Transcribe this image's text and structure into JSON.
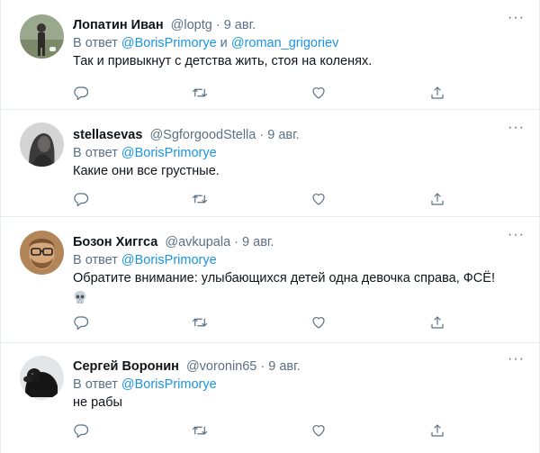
{
  "tweets": [
    {
      "name": "Лопатин Иван",
      "handle": "@loptg",
      "sep": " · ",
      "date": "9 авг.",
      "reply_prefix": "В ответ ",
      "reply_to": "@BorisPrimorye",
      "reply_and": " и ",
      "reply_to2": "@roman_grigoriev",
      "text": "Так и привыкнут с детства жить, стоя на коленях.",
      "avatar": "avatar-person-photo"
    },
    {
      "name": "stellasevas",
      "handle": "@SgforgoodStella",
      "sep": " · ",
      "date": "9 авг.",
      "reply_prefix": "В ответ ",
      "reply_to": "@BorisPrimorye",
      "text": "Какие они все грустные.",
      "avatar": "avatar-dark-portrait"
    },
    {
      "name": "Бозон Хиггса",
      "handle": "@avkupala",
      "sep": " · ",
      "date": "9 авг.",
      "reply_prefix": "В ответ ",
      "reply_to": "@BorisPrimorye",
      "text": "Обратите внимание: улыбающихся детей одна девочка справа, ФСЁ!",
      "emoji": "skull-emoji",
      "avatar": "avatar-bearded-man"
    },
    {
      "name": "Сергей Воронин",
      "handle": "@voronin65",
      "sep": " · ",
      "date": "9 авг.",
      "reply_prefix": "В ответ ",
      "reply_to": "@BorisPrimorye",
      "text": "не рабы",
      "avatar": "avatar-black-dog"
    }
  ],
  "icons": {
    "reply": "reply-icon",
    "retweet": "retweet-icon",
    "like": "heart-icon",
    "share": "share-icon",
    "more": "more-icon"
  },
  "colors": {
    "link": "#1b95e0",
    "muted": "#5b7083",
    "text": "#0f1419",
    "divider": "#e6ecf0"
  }
}
